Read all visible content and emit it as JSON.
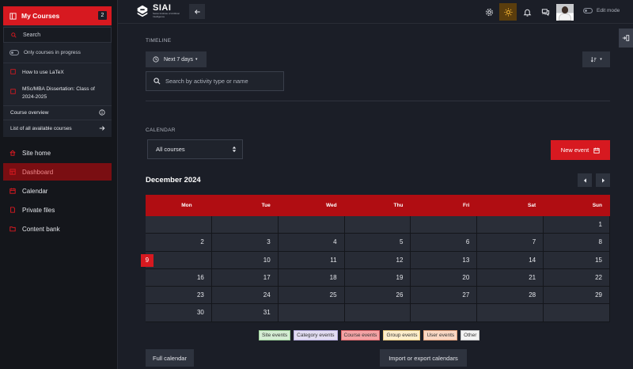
{
  "sidebar": {
    "my_courses": {
      "label": "My Courses",
      "count": "2"
    },
    "search_label": "Search",
    "toggle_label": "Only courses in progress",
    "courses": [
      {
        "name": "How to use LaTeX"
      },
      {
        "name": "MSc/MBA Dissertation: Class of 2024-2025"
      }
    ],
    "course_overview": "Course overview",
    "all_courses": "List of all available courses",
    "nav": [
      {
        "label": "Site home",
        "icon": "home-icon"
      },
      {
        "label": "Dashboard",
        "icon": "dashboard-icon",
        "active": true
      },
      {
        "label": "Calendar",
        "icon": "calendar-icon"
      },
      {
        "label": "Private files",
        "icon": "file-icon"
      },
      {
        "label": "Content bank",
        "icon": "folder-icon"
      }
    ]
  },
  "topbar": {
    "logo_text": "SIAI",
    "logo_subtext": "Swiss Institute of Artificial Intelligence",
    "edit_mode": "Edit mode"
  },
  "timeline": {
    "heading": "TIMELINE",
    "range": "Next 7 days",
    "search_placeholder": "Search by activity type or name"
  },
  "calendar": {
    "heading": "CALENDAR",
    "course_select": "All courses",
    "new_event": "New event",
    "month": "December 2024",
    "weekdays": [
      "Mon",
      "Tue",
      "Wed",
      "Thu",
      "Fri",
      "Sat",
      "Sun"
    ],
    "weeks": [
      [
        "",
        "",
        "",
        "",
        "",
        "",
        "1"
      ],
      [
        "2",
        "3",
        "4",
        "5",
        "6",
        "7",
        "8"
      ],
      [
        "9",
        "10",
        "11",
        "12",
        "13",
        "14",
        "15"
      ],
      [
        "16",
        "17",
        "18",
        "19",
        "20",
        "21",
        "22"
      ],
      [
        "23",
        "24",
        "25",
        "26",
        "27",
        "28",
        "29"
      ],
      [
        "30",
        "31",
        "",
        "",
        "",
        "",
        ""
      ]
    ],
    "today": "9",
    "legend": [
      {
        "label": "Site events",
        "bg": "#d4edd3",
        "border": "#9bcf98"
      },
      {
        "label": "Category events",
        "bg": "#e1dcf2",
        "border": "#b7aee0"
      },
      {
        "label": "Course events",
        "bg": "#f4a3a5",
        "border": "#e0686b"
      },
      {
        "label": "Group events",
        "bg": "#fdeecb",
        "border": "#e8c77a"
      },
      {
        "label": "User events",
        "bg": "#f9d7c3",
        "border": "#e3a27c"
      },
      {
        "label": "Other",
        "bg": "#f3f3f3",
        "border": "#c9c9c9"
      }
    ],
    "full_calendar": "Full calendar",
    "import_export": "Import or export calendars"
  },
  "colors": {
    "accent": "#d71920",
    "header_red": "#b00d12"
  }
}
